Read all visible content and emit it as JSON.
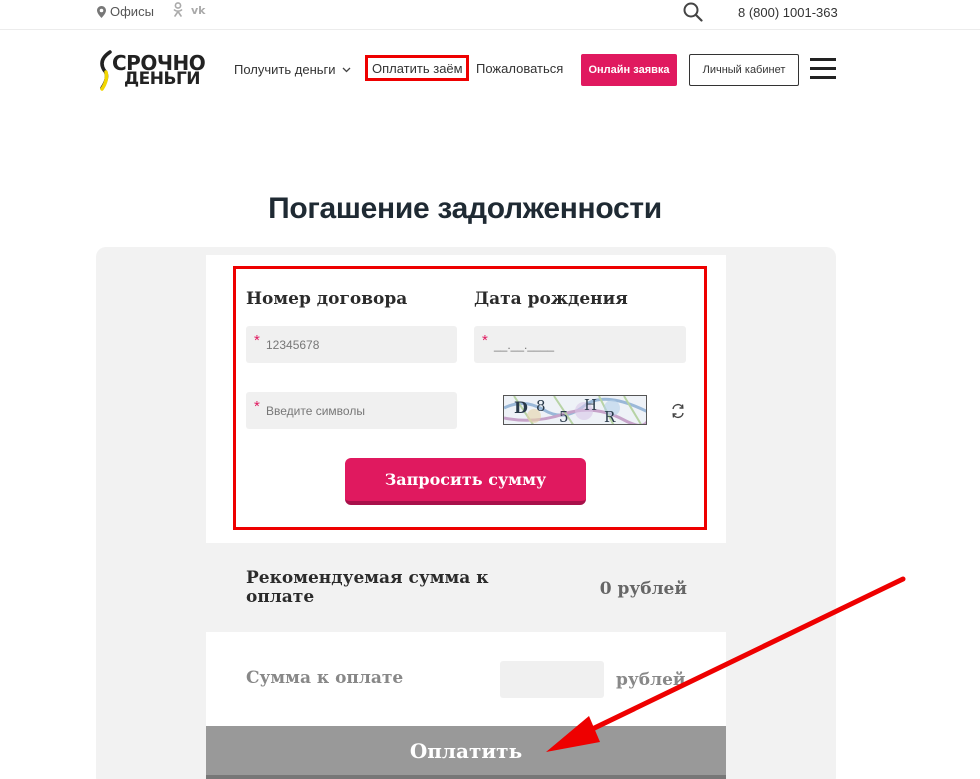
{
  "topbar": {
    "offices_label": "Офисы",
    "social": [
      "ok-icon",
      "vk-icon"
    ],
    "social_text": [
      "ok",
      "vk"
    ],
    "phone": "8 (800) 1001-363"
  },
  "header": {
    "logo_line1": "СРОЧНО",
    "logo_line2": "ДЕНЬГИ",
    "nav": {
      "get_money": "Получить деньги",
      "pay_loan": "Оплатить заём",
      "complain": "Пожаловаться"
    },
    "apply_button": "Онлайн заявка",
    "cabinet_button": "Личный кабинет"
  },
  "page": {
    "title": "Погашение задолженности"
  },
  "form": {
    "contract_label": "Номер договора",
    "birth_label": "Дата рождения",
    "contract_placeholder": "12345678",
    "birth_placeholder": "__.__.____",
    "captcha_placeholder": "Введите символы",
    "captcha_chars": [
      "D",
      "8",
      "5",
      "H",
      "R"
    ],
    "required_mark": "*",
    "request_button": "Запросить сумму"
  },
  "summary": {
    "recommended_label": "Рекомендуемая сумма к оплате",
    "recommended_value": "0 рублей",
    "sum_label": "Сумма к оплате",
    "sum_unit": "рублей",
    "pay_button": "Оплатить"
  },
  "colors": {
    "accent": "#e0195f",
    "annotation": "#ee0000",
    "disabled": "#999999"
  }
}
